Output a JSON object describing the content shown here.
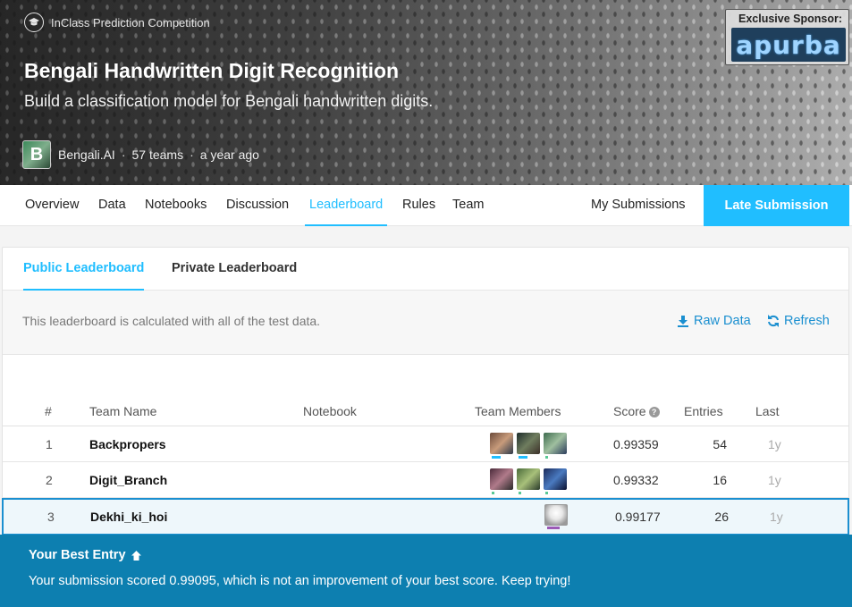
{
  "hero": {
    "competition_type": "InClass Prediction Competition",
    "title": "Bengali Handwritten Digit Recognition",
    "subtitle": "Build a classification model for Bengali handwritten digits.",
    "host_logo_letter": "B",
    "host_name": "Bengali.AI",
    "teams": "57 teams",
    "time_ago": "a year ago",
    "sponsor_label": "Exclusive Sponsor:",
    "sponsor_name": "apurba"
  },
  "tabs": {
    "overview": "Overview",
    "data": "Data",
    "notebooks": "Notebooks",
    "discussion": "Discussion",
    "leaderboard": "Leaderboard",
    "rules": "Rules",
    "team": "Team",
    "my_submissions": "My Submissions",
    "late_submission": "Late Submission",
    "active": "Leaderboard"
  },
  "leaderboard": {
    "tabs": {
      "public": "Public Leaderboard",
      "private": "Private Leaderboard",
      "active": "Public Leaderboard"
    },
    "info_text": "This leaderboard is calculated with all of the test data.",
    "raw_data": "Raw Data",
    "refresh": "Refresh",
    "columns": {
      "rank": "#",
      "team_name": "Team Name",
      "notebook": "Notebook",
      "team_members": "Team Members",
      "score": "Score",
      "entries": "Entries",
      "last": "Last"
    },
    "rows": [
      {
        "rank": "1",
        "team_name": "Backpropers",
        "score": "0.99359",
        "entries": "54",
        "last": "1y"
      },
      {
        "rank": "2",
        "team_name": "Digit_Branch",
        "score": "0.99332",
        "entries": "16",
        "last": "1y"
      },
      {
        "rank": "3",
        "team_name": "Dekhi_ki_hoi",
        "score": "0.99177",
        "entries": "26",
        "last": "1y"
      }
    ]
  },
  "banner": {
    "heading": "Your Best Entry",
    "message": "Your submission scored 0.99095, which is not an improvement of your best score. Keep trying!"
  },
  "colors": {
    "accent": "#20beff",
    "banner": "#0d7fb0",
    "link": "#1a8fd0",
    "tier_contributor": "#20beff",
    "tier_novice": "#5ac995",
    "tier_grandmaster": "#9b59b6"
  }
}
